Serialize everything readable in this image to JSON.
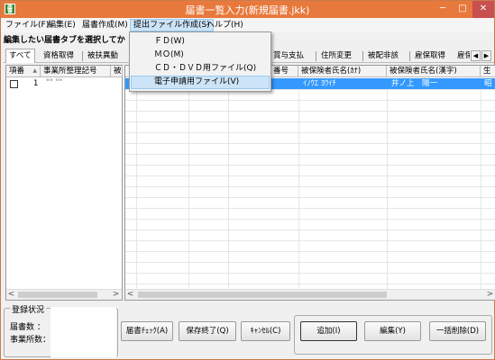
{
  "window": {
    "title": "届書一覧入力(新規届書.jkk)",
    "icon_text": "届書",
    "min_glyph": "─",
    "max_glyph": "□",
    "close_glyph": "✕"
  },
  "menu": {
    "items": [
      "ファイル(F)",
      "編集(E)",
      "届書作成(M)",
      "提出ファイル作成(S)",
      "ヘルプ(H)"
    ]
  },
  "instruction": "編集したい届書タブを選択してか",
  "tabs": {
    "items": [
      "すべて",
      "資格取得",
      "被扶異動",
      "賞与支払",
      "住所変更",
      "被配非該",
      "雇保取得",
      "雇保"
    ],
    "scroll_left": "◀",
    "scroll_right": "▶"
  },
  "left_grid": {
    "headers": [
      "項番",
      "事業所整理記号",
      "被"
    ],
    "sort_glyph": "▲",
    "rows": [
      {
        "no": "1",
        "code": "\"\" \"\""
      }
    ]
  },
  "right_grid": {
    "headers": [
      "",
      "",
      "",
      "番号",
      "被保険者氏名(ｶﾅ)",
      "被保険者氏名(漢字)",
      "生"
    ],
    "rows": [
      {
        "kana": "ｲﾉｳｴ ﾖｳｲﾁ",
        "kanji": "井ノ上　陽一",
        "birth": "昭"
      }
    ]
  },
  "scroll_glyphs": {
    "left": "<",
    "right": ">"
  },
  "dropdown": {
    "items": [
      "ＦＤ(W)",
      "ＭＯ(M)",
      "ＣＤ・ＤＶＤ用ファイル(Q)",
      "電子申請用ファイル(V)"
    ],
    "highlighted_index": 3
  },
  "status": {
    "legend": "登録状況",
    "count_label": "届書数 ：",
    "office_label": "事業所数："
  },
  "buttons": {
    "check": "届書ﾁｪｯｸ(A)",
    "save": "保存終了(Q)",
    "cancel": "ｷｬﾝｾﾙ(C)",
    "add": "追加(I)",
    "edit": "編集(Y)",
    "bulk_delete": "一括削除(D)"
  }
}
